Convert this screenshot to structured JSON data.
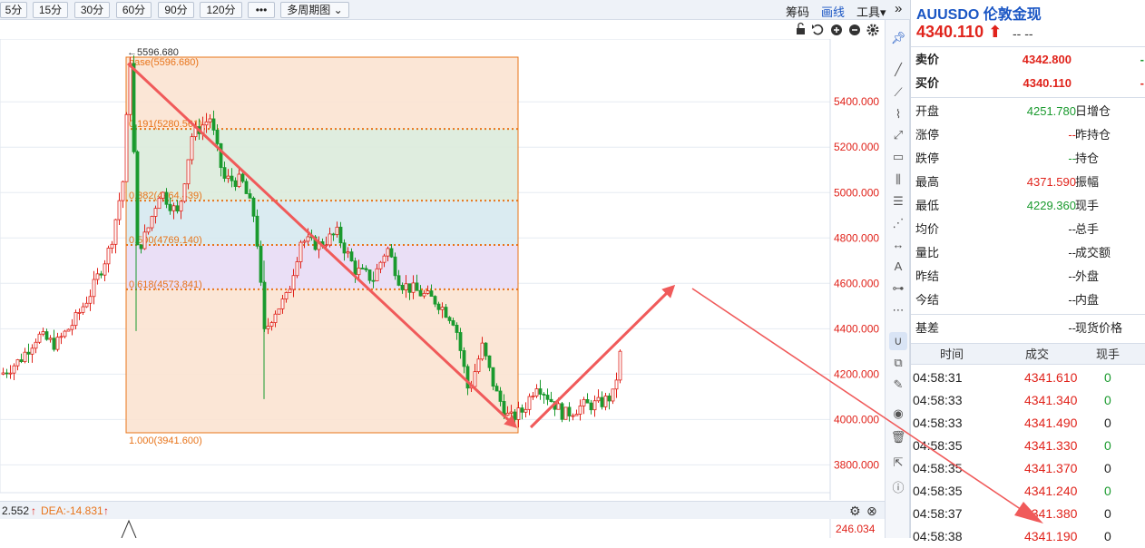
{
  "toolbar": {
    "periods": [
      "5分",
      "15分",
      "30分",
      "60分",
      "90分",
      "120分"
    ],
    "more": "•••",
    "multi": "多周期图",
    "right": {
      "chips": "筹码",
      "draw": "画线",
      "tools": "工具▾",
      "collapse": "»"
    }
  },
  "chart": {
    "high_label": "←5596.680",
    "y_ticks": [
      "5400.000",
      "5200.000",
      "5000.000",
      "4800.000",
      "4600.000",
      "4400.000",
      "4200.000",
      "4000.000",
      "3800.000"
    ],
    "fib": [
      {
        "label": "base(5596.680)",
        "value": 5596.68
      },
      {
        "label": "0.191(5280.561)",
        "value": 5280.561
      },
      {
        "label": "0.382(4964.439)",
        "value": 4964.439
      },
      {
        "label": "0.500(4769.140)",
        "value": 4769.14
      },
      {
        "label": "0.618(4573.841)",
        "value": 4573.841
      },
      {
        "label": "1.000(3941.600)",
        "value": 3941.6
      }
    ],
    "colors": {
      "up": "#e0231b",
      "down": "#1a9a2e",
      "fib_line": "#e8741a"
    }
  },
  "macd": {
    "diff": "2.552",
    "dea": "DEA:-14.831",
    "value": "246.034"
  },
  "panel": {
    "symbol": "AUUSDO 伦敦金现",
    "price": "4340.110 ⬆",
    "price_tail": "--  --",
    "sell_label": "卖价",
    "sell": "4342.800",
    "buy_label": "买价",
    "buy": "4340.110",
    "stats": [
      {
        "l": "开盘",
        "v": "4251.780",
        "r": "日增仓",
        "c": "green"
      },
      {
        "l": "涨停",
        "v": "--",
        "r": "昨持仓",
        "c": "red"
      },
      {
        "l": "跌停",
        "v": "--",
        "r": "持仓",
        "c": "green"
      },
      {
        "l": "最高",
        "v": "4371.590",
        "r": "振幅",
        "c": "red"
      },
      {
        "l": "最低",
        "v": "4229.360",
        "r": "现手",
        "c": "green"
      },
      {
        "l": "均价",
        "v": "--",
        "r": "总手",
        "c": "dark"
      },
      {
        "l": "量比",
        "v": "--",
        "r": "成交额",
        "c": "dark"
      },
      {
        "l": "昨结",
        "v": "--",
        "r": "外盘",
        "c": "dark"
      },
      {
        "l": "今结",
        "v": "--",
        "r": "内盘",
        "c": "dark"
      }
    ],
    "basis": {
      "l": "基差",
      "v": "--",
      "r": "现货价格"
    },
    "ticks_head": {
      "time": "时间",
      "price": "成交",
      "vol": "现手"
    },
    "ticks": [
      {
        "t": "04:58:31",
        "p": "4341.610",
        "v": "0",
        "c": "green"
      },
      {
        "t": "04:58:33",
        "p": "4341.340",
        "v": "0",
        "c": "green"
      },
      {
        "t": "04:58:33",
        "p": "4341.490",
        "v": "0",
        "c": "dark"
      },
      {
        "t": "04:58:35",
        "p": "4341.330",
        "v": "0",
        "c": "green"
      },
      {
        "t": "04:58:35",
        "p": "4341.370",
        "v": "0",
        "c": "dark"
      },
      {
        "t": "04:58:35",
        "p": "4341.240",
        "v": "0",
        "c": "green"
      },
      {
        "t": "04:58:37",
        "p": "4341.380",
        "v": "0",
        "c": "dark"
      },
      {
        "t": "04:58:38",
        "p": "4341.190",
        "v": "0",
        "c": "dark"
      }
    ]
  }
}
